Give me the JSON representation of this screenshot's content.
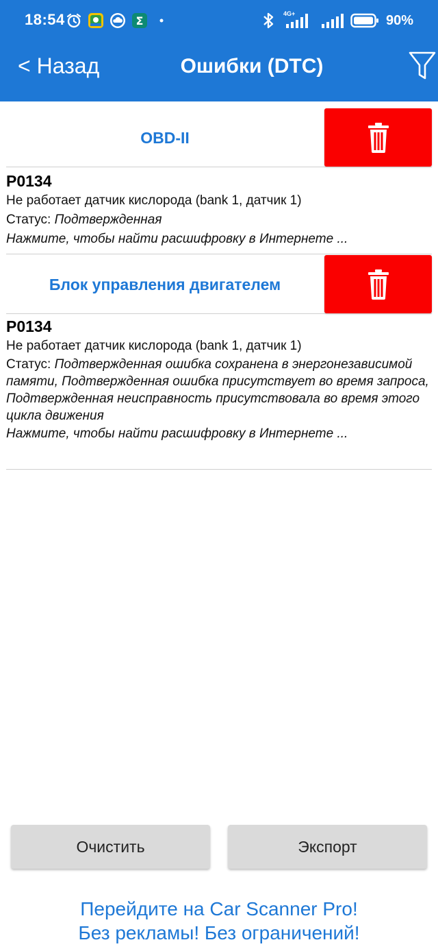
{
  "status_bar": {
    "time": "18:54",
    "battery": "90%",
    "network": "4G+",
    "icons": [
      "alarm-icon",
      "maps-app-icon",
      "cloud-app-icon",
      "sigma-app-icon",
      "notification-dot-icon",
      "bluetooth-icon",
      "signal-icon",
      "signal-icon-2",
      "battery-icon"
    ]
  },
  "nav": {
    "back_label": "< Назад",
    "title": "Ошибки (DTC)",
    "filter_icon": "filter-icon"
  },
  "sections": [
    {
      "title": "OBD-II",
      "delete_icon": "trash-icon",
      "dtc": {
        "code": "P0134",
        "description": "Не работает датчик кислорода (bank 1, датчик 1)",
        "status_label": "Статус: ",
        "status_value": "Подтвержденная",
        "hint": "Нажмите, чтобы найти расшифровку в Интернете ..."
      }
    },
    {
      "title": "Блок управления двигателем",
      "delete_icon": "trash-icon",
      "dtc": {
        "code": "P0134",
        "description": "Не работает датчик кислорода (bank 1, датчик 1)",
        "status_label": "Статус: ",
        "status_value": "Подтвержденная ошибка сохранена в энергонезависимой памяти, Подтвержденная ошибка присутствует во время запроса, Подтвержденная неисправность присутствовала во время этого цикла движения",
        "hint": "Нажмите, чтобы найти расшифровку в Интернете ..."
      }
    }
  ],
  "buttons": {
    "clear": "Очистить",
    "export": "Экспорт"
  },
  "promo": {
    "line1": "Перейдите на Car Scanner Pro!",
    "line2": "Без рекламы! Без ограничений!"
  },
  "colors": {
    "accent": "#1e78d6",
    "delete": "#fa0000",
    "button_bg": "#dadada"
  }
}
